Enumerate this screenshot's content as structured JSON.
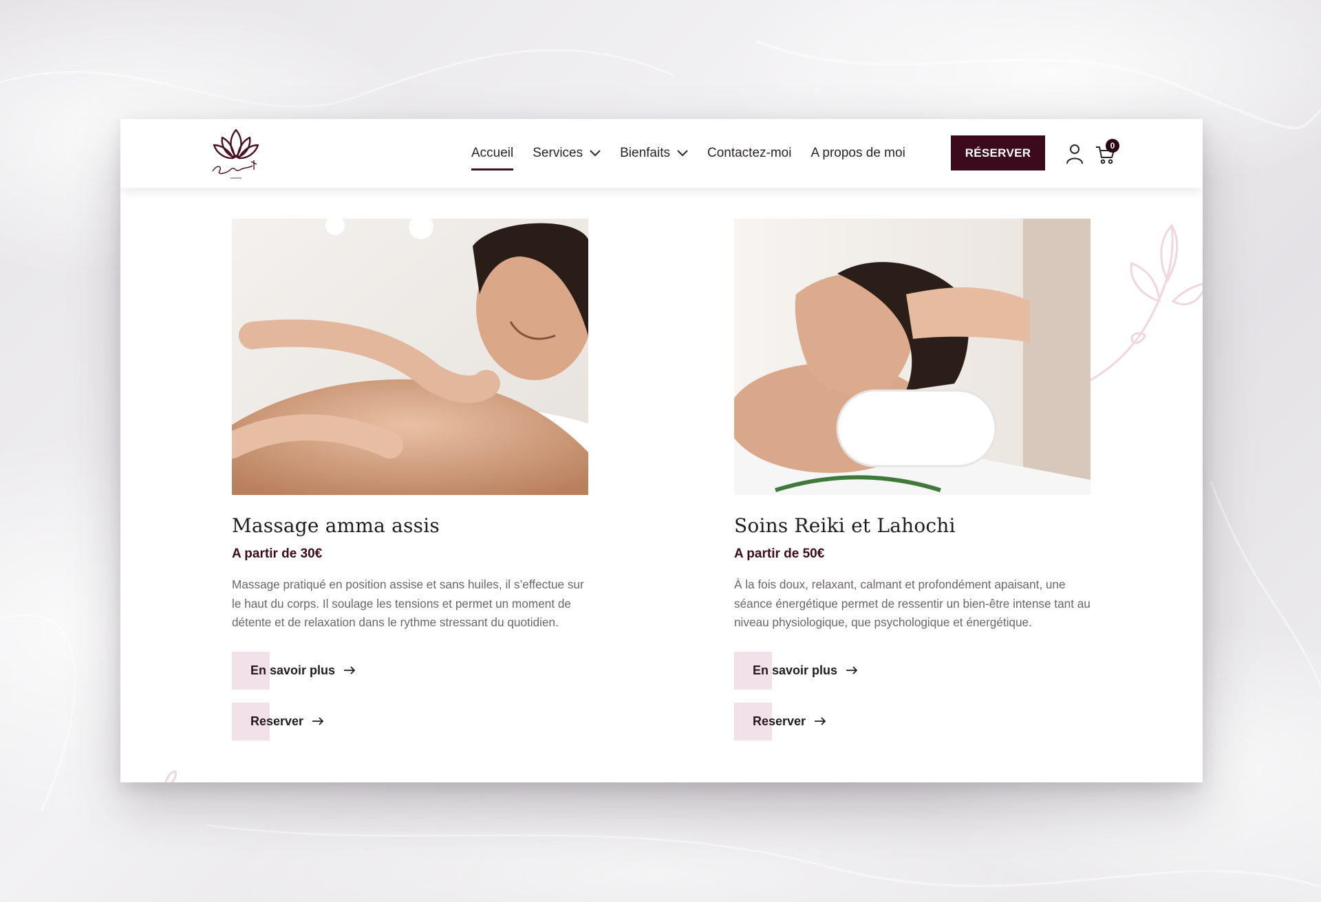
{
  "header": {
    "logo_alt": "Sandrine F",
    "nav": [
      {
        "label": "Accueil",
        "active": true,
        "has_dropdown": false
      },
      {
        "label": "Services",
        "active": false,
        "has_dropdown": true
      },
      {
        "label": "Bienfaits",
        "active": false,
        "has_dropdown": true
      },
      {
        "label": "Contactez-moi",
        "active": false,
        "has_dropdown": false
      },
      {
        "label": "A propos de moi",
        "active": false,
        "has_dropdown": false
      }
    ],
    "cta_label": "RÉSERVER",
    "cart_count": "0"
  },
  "cards": [
    {
      "title": "Massage amma assis",
      "price": "A partir de 30€",
      "description": "Massage pratiqué en position assise et sans huiles, il s’effectue sur le haut du corps. Il soulage les tensions et permet un moment de détente et de relaxation dans le rythme stressant du quotidien.",
      "more_label": "En savoir plus",
      "book_label": "Reserver"
    },
    {
      "title": "Soins Reiki et Lahochi",
      "price": "A partir de 50€",
      "description": "À la fois doux, relaxant, calmant et profondément apaisant, une séance énergétique permet de ressentir un bien-être intense tant au niveau physiologique, que psychologique et énergétique.",
      "more_label": "En savoir plus",
      "book_label": "Reserver"
    }
  ],
  "colors": {
    "brand": "#3b0a1c",
    "accent_pink": "#f2e1e8",
    "text": "#231a1e",
    "muted": "#6e6469"
  },
  "icons": [
    "lotus-logo-icon",
    "chevron-down-icon",
    "user-icon",
    "cart-icon",
    "arrow-right-icon",
    "leaf-branch-icon"
  ]
}
